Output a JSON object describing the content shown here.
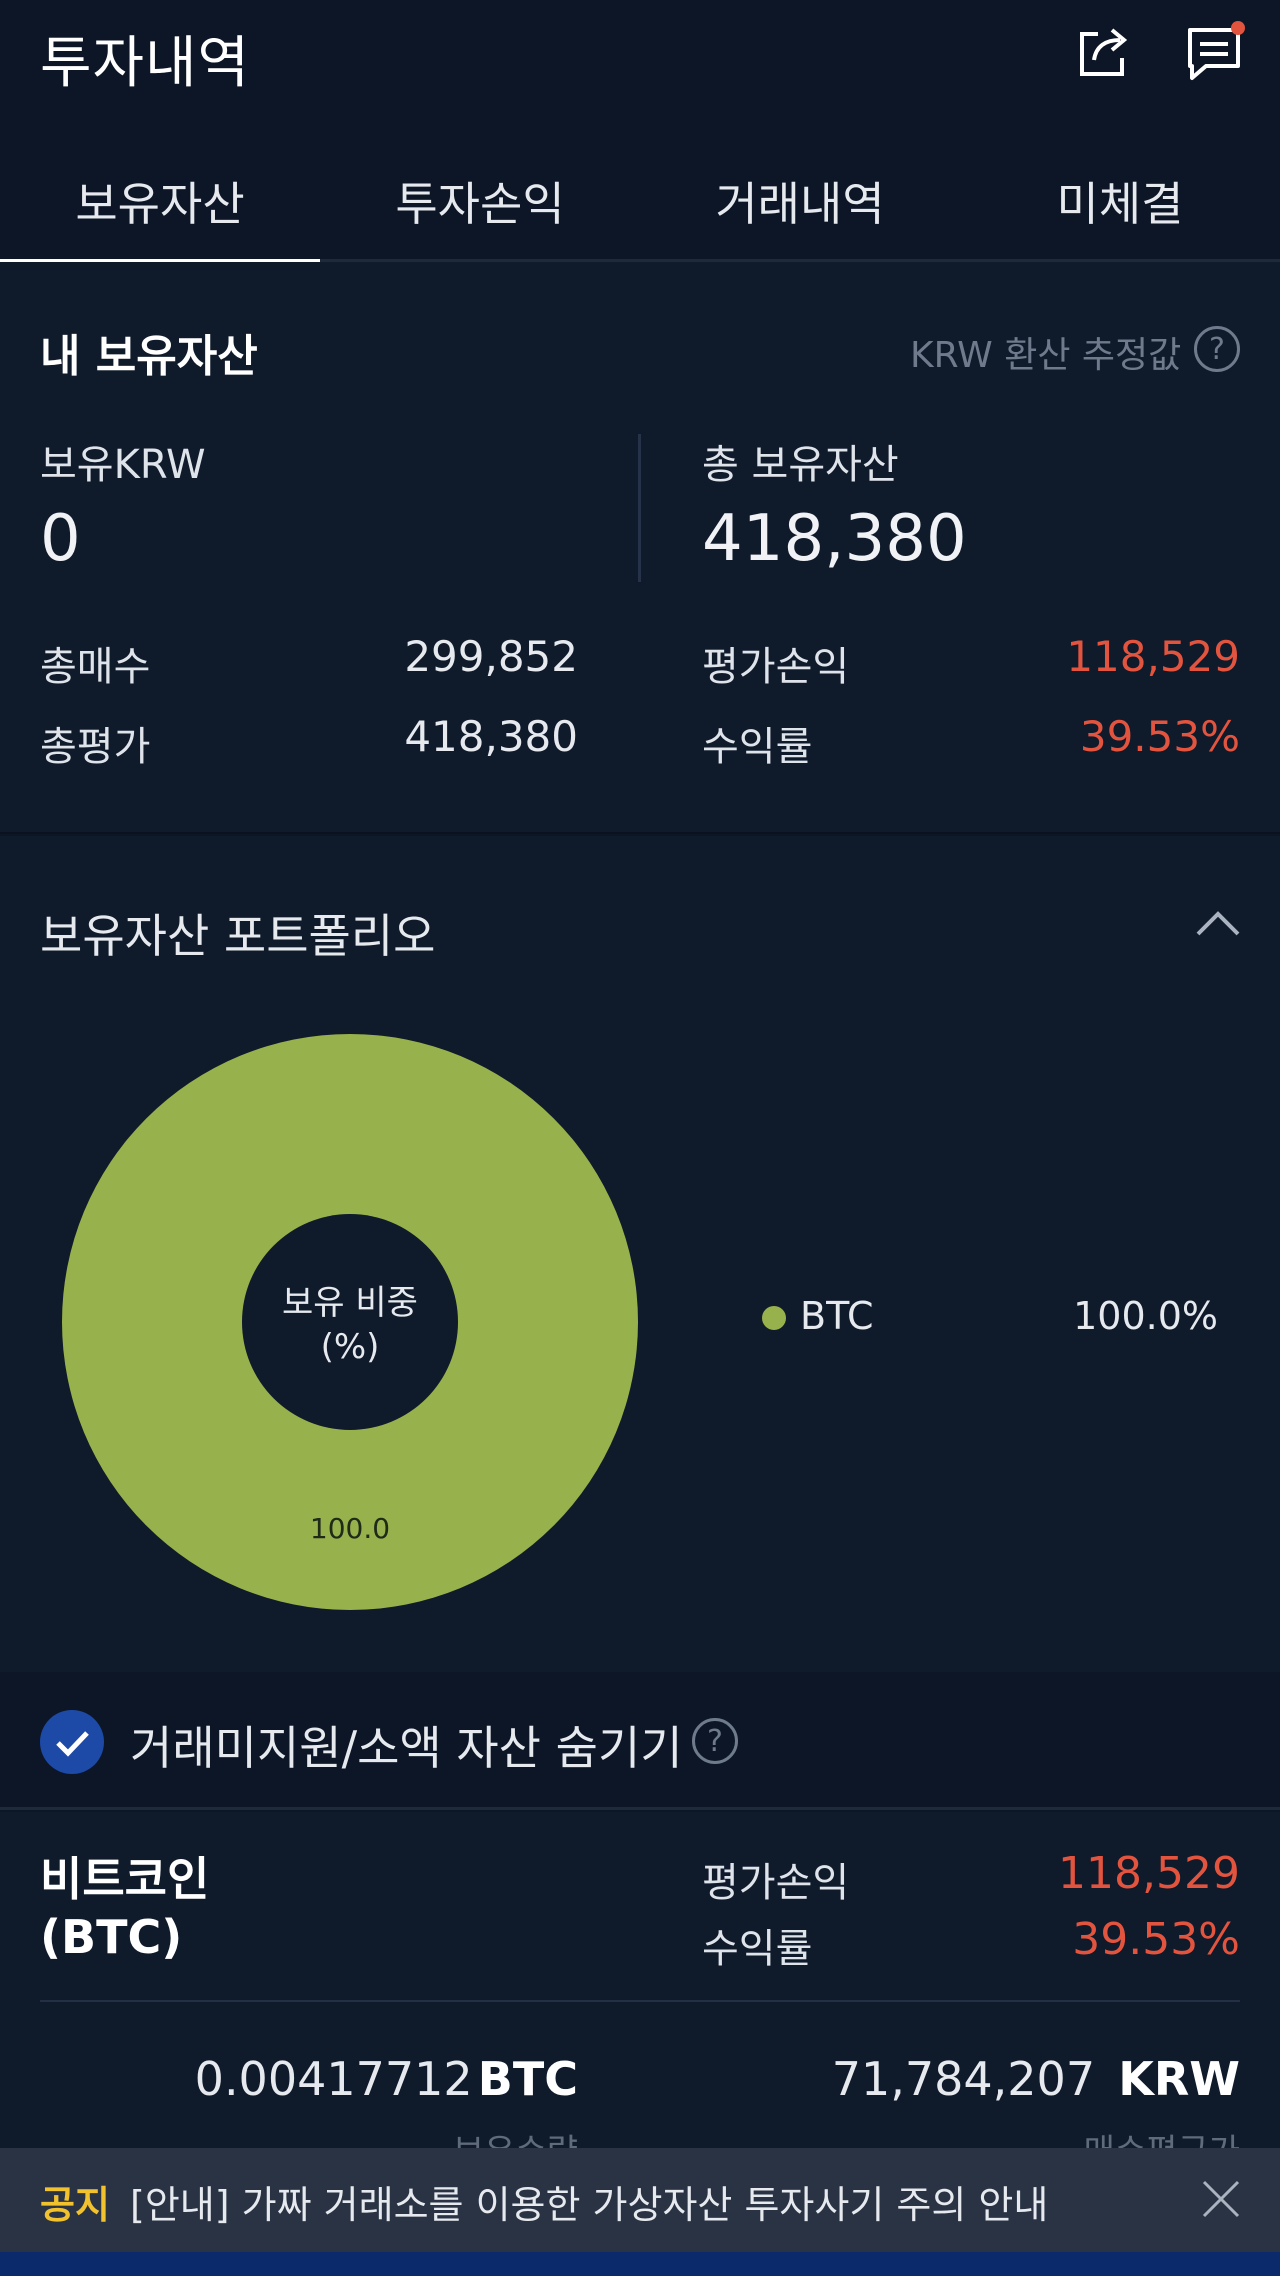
{
  "header": {
    "title": "투자내역",
    "share_icon": "share-icon",
    "message_icon": "message-icon",
    "accent": "#e3543f"
  },
  "tabs": [
    {
      "label": "보유자산",
      "active": true
    },
    {
      "label": "투자손익",
      "active": false
    },
    {
      "label": "거래내역",
      "active": false
    },
    {
      "label": "미체결",
      "active": false
    }
  ],
  "holdings": {
    "title": "내 보유자산",
    "krw_note": "KRW 환산 추정값",
    "krw_label": "보유KRW",
    "krw_value": "0",
    "total_label": "총 보유자산",
    "total_value": "418,380",
    "buy_label": "총매수",
    "buy_value": "299,852",
    "eval_label": "총평가",
    "eval_value": "418,380",
    "pnl_label": "평가손익",
    "pnl_value": "118,529",
    "rate_label": "수익률",
    "rate_value": "39.53%"
  },
  "portfolio": {
    "title": "보유자산 포트폴리오",
    "center_label_1": "보유 비중",
    "center_label_2": "(%)",
    "slice_label": "100.0",
    "legend": [
      {
        "name": "BTC",
        "pct": "100.0%",
        "color": "#97b14c"
      }
    ]
  },
  "chart_data": {
    "type": "pie",
    "categories": [
      "BTC"
    ],
    "values": [
      100.0
    ],
    "colors": [
      "#97b14c"
    ]
  },
  "hide_small": {
    "label": "거래미지원/소액 자산 숨기기",
    "checked": true
  },
  "coin": {
    "name_line1": "비트코인",
    "name_line2": "(BTC)",
    "pnl_label": "평가손익",
    "pnl_value": "118,529",
    "rate_label": "수익률",
    "rate_value": "39.53%",
    "quantity": "0.00417712",
    "quantity_unit": "BTC",
    "quantity_label": "보유수량",
    "avg_price": "71,784,207",
    "avg_unit": "KRW",
    "avg_label": "매수평균가"
  },
  "notice": {
    "tag": "공지",
    "text": "[안내] 가짜 거래소를 이용한 가상자산 투자사기 주의 안내"
  }
}
